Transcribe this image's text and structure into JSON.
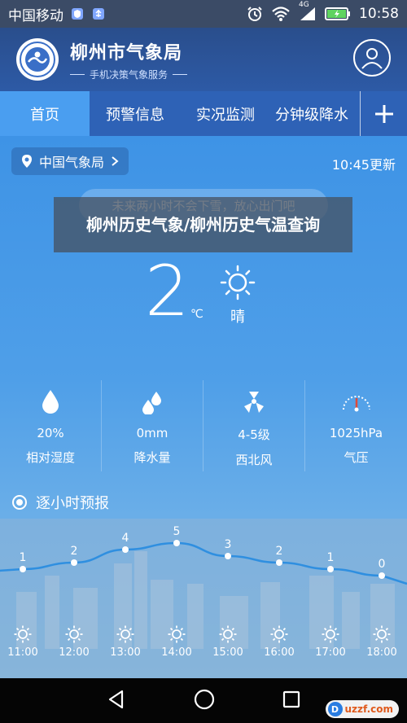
{
  "status_bar": {
    "carrier": "中国移动",
    "network": "4G",
    "time": "10:58"
  },
  "header": {
    "title": "柳州市气象局",
    "subtitle": "手机决策气象服务"
  },
  "tabs": [
    {
      "label": "首页",
      "active": true
    },
    {
      "label": "预警信息",
      "active": false
    },
    {
      "label": "实况监测",
      "active": false
    },
    {
      "label": "分钟级降水",
      "active": false
    }
  ],
  "location": {
    "name": "中国气象局",
    "update_time": "10:45更新"
  },
  "tip": "未来两小时不会下雪，放心出门吧",
  "current": {
    "temperature": "2",
    "unit": "℃",
    "condition": "晴",
    "icon": "sun-icon"
  },
  "overlay_title": "柳州历史气象/柳州历史气温查询",
  "stats": [
    {
      "value": "20%",
      "label": "相对湿度",
      "icon": "humidity-drop-icon"
    },
    {
      "value": "0mm",
      "label": "降水量",
      "icon": "rain-drops-icon"
    },
    {
      "value": "4-5级",
      "label": "西北风",
      "icon": "wind-fan-icon"
    },
    {
      "value": "1025hPa",
      "label": "气压",
      "icon": "pressure-gauge-icon"
    }
  ],
  "hourly": {
    "title": "逐小时预报",
    "temps": [
      {
        "value": "1",
        "t": 1
      },
      {
        "value": "2",
        "t": 2
      },
      {
        "value": "4",
        "t": 4
      },
      {
        "value": "5",
        "t": 5
      },
      {
        "value": "3",
        "t": 3
      },
      {
        "value": "2",
        "t": 2
      },
      {
        "value": "1",
        "t": 1
      },
      {
        "value": "0",
        "t": 0
      }
    ],
    "times": [
      "11:00",
      "12:00",
      "13:00",
      "14:00",
      "15:00",
      "16:00",
      "17:00",
      "18:00"
    ]
  },
  "watermark": {
    "label": "uzzf.com"
  },
  "colors": {
    "status_bar": "#3b4b66",
    "header": "#2d5aa6",
    "tab_active": "#4a9ef0",
    "sky": "#4f9fe8"
  }
}
